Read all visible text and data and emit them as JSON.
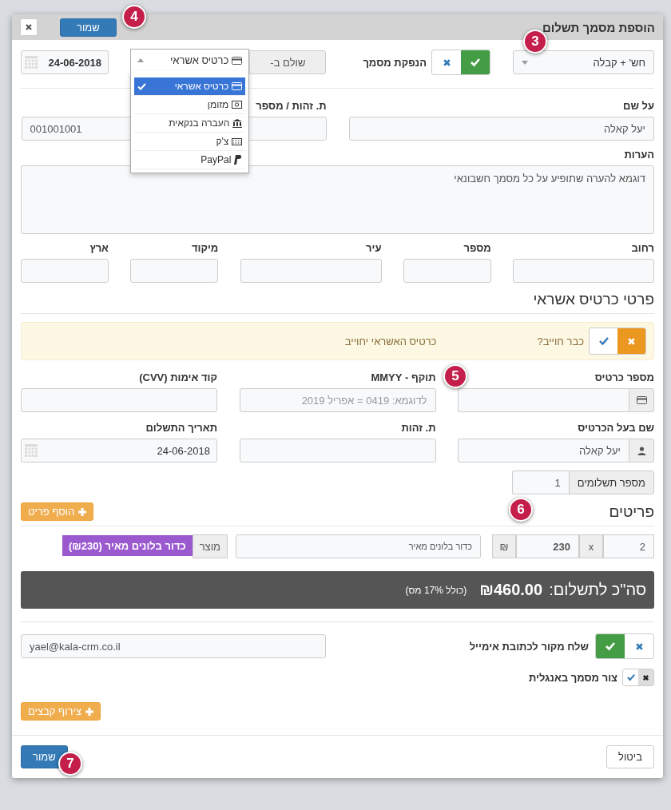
{
  "dialog": {
    "title": "הוספת מסמך תשלום",
    "save_label": "שמור"
  },
  "header_row": {
    "doc_type": "חש' + קבלה",
    "issue_doc": {
      "label": "הנפקת מסמך",
      "on": true
    },
    "paid_by_label": "שולם ב-",
    "paid_by_value": "כרטיס אשראי",
    "date": "24-06-2018"
  },
  "payment_menu": [
    {
      "label": "כרטיס אשראי",
      "kind": "card",
      "selected": true
    },
    {
      "label": "מזומן",
      "kind": "cash",
      "selected": false
    },
    {
      "label": "העברה בנקאית",
      "kind": "bank",
      "selected": false
    },
    {
      "label": "צ'ק",
      "kind": "check",
      "selected": false
    },
    {
      "label": "PayPal",
      "kind": "paypal",
      "selected": false
    }
  ],
  "client": {
    "name_label": "על שם",
    "name_value": "יעל קאלה",
    "id_label": "ת. זהות / מספר",
    "id_value": "001001001",
    "notes_label": "הערות",
    "notes_value": "דוגמא להערה שתופיע על כל מסמך חשבונאי"
  },
  "address_fields": [
    "רחוב",
    "מספר",
    "עיר",
    "מיקוד",
    "ארץ"
  ],
  "credit": {
    "title": "פרטי כרטיס אשראי",
    "charged": {
      "label": "כבר חוייב?",
      "on": false
    },
    "message": "כרטיס האשראי יחוייב",
    "card_label": "מספר כרטיס",
    "expiry_label": "תוקף - MMYY",
    "expiry_placeholder": "לדוגמא: 0419 = אפריל 2019",
    "cvv_label": "קוד אימות (CVV)",
    "holder_label": "שם בעל הכרטיס",
    "holder_value": "יעל קאלה",
    "holder_id_label": "ת. זהות",
    "pay_date_label": "תאריך התשלום",
    "pay_date_value": "24-06-2018",
    "installments_label": "מספר תשלומים",
    "installments_value": "1"
  },
  "items": {
    "title": "פריטים",
    "add_label": "הוסף פריט",
    "row": {
      "qty": "2",
      "times": "x",
      "price": "230",
      "currency": "₪",
      "description": "כדור בלונים מאיר",
      "product_label": "מוצר",
      "product_tag": "כדור בלונים מאיר (₪230)"
    }
  },
  "total": {
    "label": "סה\"כ לתשלום:",
    "amount": "₪460.00",
    "tax_note": "(כולל 17% מס)"
  },
  "email": {
    "label": "שלח מקור לכתובת אימייל",
    "on": true,
    "value": "yael@kala-crm.co.il"
  },
  "english": {
    "label": "צור מסמך באנגלית",
    "on": false
  },
  "attach_label": "צירוף קבצים",
  "footer": {
    "save_label": "שמור",
    "cancel_label": "ביטול"
  },
  "callouts": [
    "3",
    "4",
    "5",
    "6",
    "7"
  ]
}
